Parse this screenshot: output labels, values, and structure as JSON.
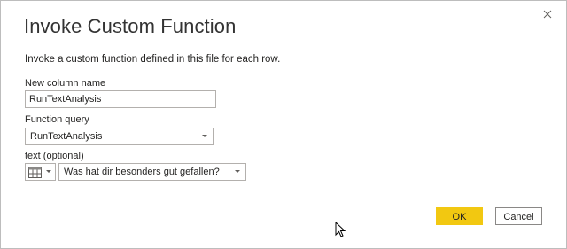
{
  "dialog": {
    "title": "Invoke Custom Function",
    "description": "Invoke a custom function defined in this file for each row.",
    "close_icon": "close-icon"
  },
  "fields": {
    "new_column_name": {
      "label": "New column name",
      "value": "RunTextAnalysis"
    },
    "function_query": {
      "label": "Function query",
      "selected": "RunTextAnalysis"
    },
    "text_param": {
      "label": "text (optional)",
      "type_icon": "table-icon",
      "selected": "Was hat dir besonders gut gefallen?"
    }
  },
  "buttons": {
    "ok_label": "OK",
    "cancel_label": "Cancel"
  },
  "colors": {
    "accent": "#f2c811",
    "border": "#b3b0ad",
    "text": "#252423"
  }
}
